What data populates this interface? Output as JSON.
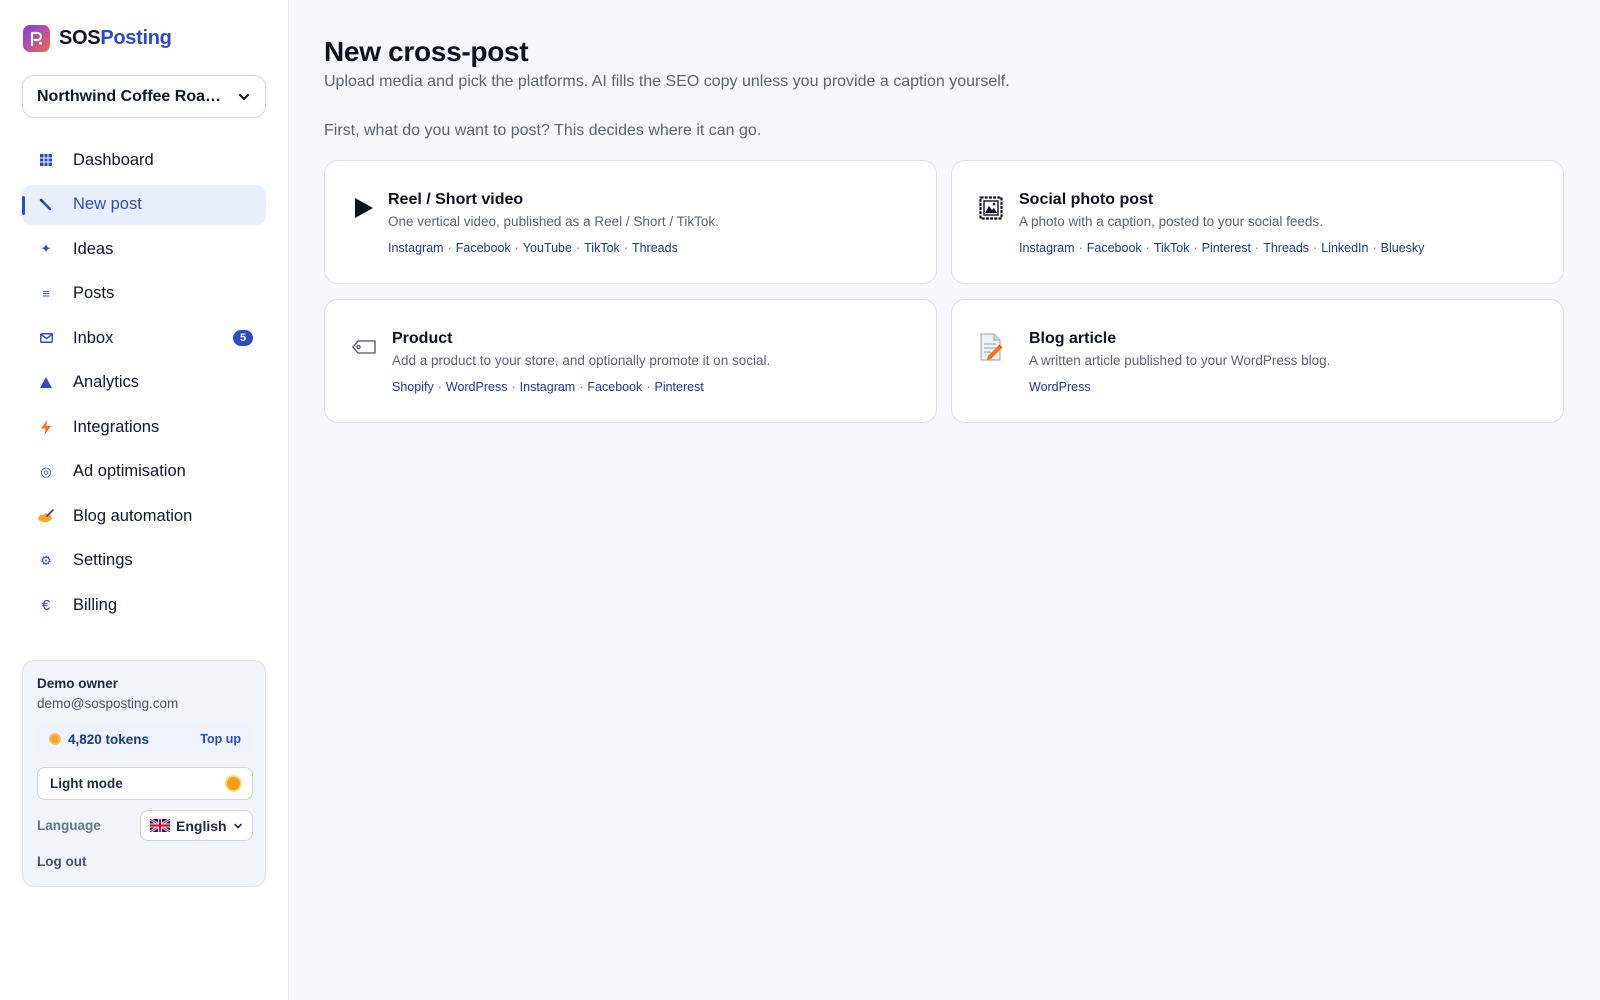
{
  "brand": {
    "part1": "SOS",
    "part2": "Posting"
  },
  "workspace": {
    "name": "Northwind Coffee Roas…"
  },
  "nav": [
    {
      "label": "Dashboard",
      "icon": "grid-icon"
    },
    {
      "label": "New post",
      "icon": "pencil-icon",
      "active": true
    },
    {
      "label": "Ideas",
      "icon": "sparkle-icon"
    },
    {
      "label": "Posts",
      "icon": "list-icon"
    },
    {
      "label": "Inbox",
      "icon": "envelope-icon",
      "badge": "5"
    },
    {
      "label": "Analytics",
      "icon": "triangle-icon"
    },
    {
      "label": "Integrations",
      "icon": "lightning-icon"
    },
    {
      "label": "Ad optimisation",
      "icon": "target-icon"
    },
    {
      "label": "Blog automation",
      "icon": "writing-hand-icon"
    },
    {
      "label": "Settings",
      "icon": "gear-icon"
    },
    {
      "label": "Billing",
      "icon": "euro-icon"
    }
  ],
  "account": {
    "name": "Demo owner",
    "email": "demo@sosposting.com",
    "tokens": "4,820 tokens",
    "top_up": "Top up",
    "mode": "Light mode",
    "language_label": "Language",
    "language": "English",
    "logout": "Log out"
  },
  "main": {
    "title": "New cross-post",
    "subtitle": "Upload media and pick the platforms. AI fills the SEO copy unless you provide a caption yourself.",
    "prompt": "First, what do you want to post? This decides where it can go."
  },
  "cards": [
    {
      "title": "Reel / Short video",
      "desc": "One vertical video, published as a Reel / Short / TikTok.",
      "icon": "play-icon",
      "platforms": [
        "Instagram",
        "Facebook",
        "YouTube",
        "TikTok",
        "Threads"
      ]
    },
    {
      "title": "Social photo post",
      "desc": "A photo with a caption, posted to your social feeds.",
      "icon": "framed-picture-icon",
      "platforms": [
        "Instagram",
        "Facebook",
        "TikTok",
        "Pinterest",
        "Threads",
        "LinkedIn",
        "Bluesky"
      ]
    },
    {
      "title": "Product",
      "desc": "Add a product to your store, and optionally promote it on social.",
      "icon": "price-tag-icon",
      "platforms": [
        "Shopify",
        "WordPress",
        "Instagram",
        "Facebook",
        "Pinterest"
      ]
    },
    {
      "title": "Blog article",
      "desc": "A written article published to your WordPress blog.",
      "icon": "memo-icon",
      "platforms": [
        "WordPress"
      ]
    }
  ],
  "colors": {
    "accent": "#2f49c9",
    "background": "#f7f8fc",
    "card_border": "#dcdfe6"
  }
}
